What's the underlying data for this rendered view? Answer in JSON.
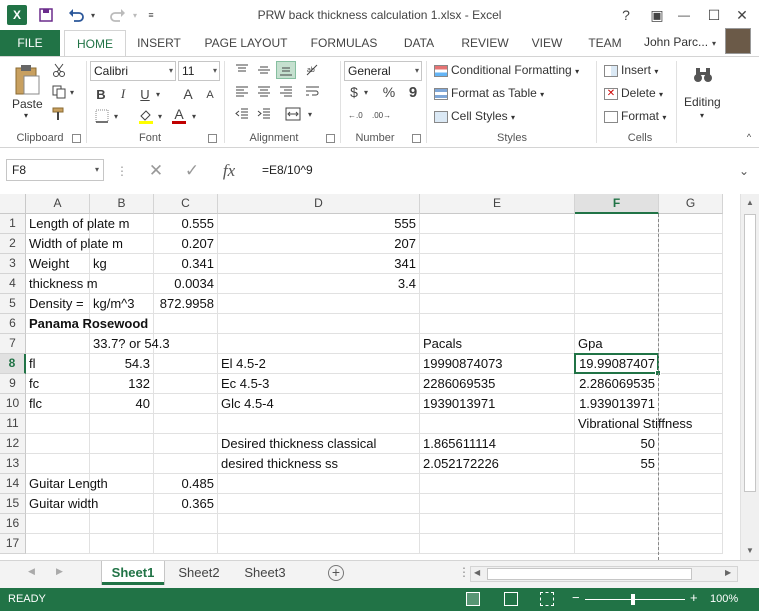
{
  "window": {
    "title": "PRW back thickness calculation 1.xlsx - Excel",
    "help": "?",
    "restore_ribbon": "▣",
    "minimize": "—",
    "maximize": "☐",
    "close": "✕",
    "logo_letter": "X"
  },
  "qat": {
    "save_icon": "save-icon",
    "undo_icon": "undo-icon",
    "redo_icon": "redo-icon"
  },
  "tabs": [
    "FILE",
    "HOME",
    "INSERT",
    "PAGE LAYOUT",
    "FORMULAS",
    "DATA",
    "REVIEW",
    "VIEW",
    "TEAM"
  ],
  "active_tab": "HOME",
  "user": {
    "name": "John Parc..."
  },
  "ribbon": {
    "clipboard": {
      "label": "Clipboard",
      "paste": "Paste"
    },
    "font": {
      "label": "Font",
      "name": "Calibri",
      "size": "11",
      "bold": "B",
      "italic": "I",
      "underline": "U",
      "grow": "A",
      "shrink": "A",
      "font_color": "A"
    },
    "alignment": {
      "label": "Alignment"
    },
    "number": {
      "label": "Number",
      "format": "General",
      "currency": "$",
      "percent": "%",
      "comma": "9"
    },
    "styles": {
      "label": "Styles",
      "conditional": "Conditional Formatting",
      "format_table": "Format as Table",
      "cell_styles": "Cell Styles"
    },
    "cells": {
      "label": "Cells",
      "insert": "Insert",
      "delete": "Delete",
      "format": "Format"
    },
    "editing": {
      "label": "Editing"
    }
  },
  "formula_bar": {
    "name_box": "F8",
    "formula": "=E8/10^9"
  },
  "columns": [
    "A",
    "B",
    "C",
    "D",
    "E",
    "F",
    "G"
  ],
  "selected_column": "F",
  "selected_row": "8",
  "rows": [
    "1",
    "2",
    "3",
    "4",
    "5",
    "6",
    "7",
    "8",
    "9",
    "10",
    "11",
    "12",
    "13",
    "14",
    "15",
    "16",
    "17"
  ],
  "cells": {
    "r1": {
      "A": "Length of plate m",
      "B": "",
      "C": "0.555",
      "D": "555",
      "E": "",
      "F": ""
    },
    "r2": {
      "A": "Width of plate m",
      "B": "",
      "C": "0.207",
      "D": "207",
      "E": "",
      "F": ""
    },
    "r3": {
      "A": "Weight",
      "B": "kg",
      "C": "0.341",
      "D": "341",
      "E": "",
      "F": ""
    },
    "r4": {
      "A": "thickness m",
      "B": "",
      "C": "0.0034",
      "D": "3.4",
      "E": "",
      "F": ""
    },
    "r5": {
      "A": "Density =",
      "B": "kg/m^3",
      "C": "872.9958",
      "D": "",
      "E": "",
      "F": ""
    },
    "r6": {
      "A": "Panama Rosewood",
      "B": "",
      "C": "",
      "D": "",
      "E": "",
      "F": ""
    },
    "r7": {
      "A": "",
      "B": "33.7? or 54.3",
      "C": "",
      "D": "",
      "E": "Pacals",
      "F": "Gpa"
    },
    "r8": {
      "A": "fl",
      "B": "54.3",
      "C": "",
      "D": "El 4.5-2",
      "E": "19990874073",
      "F": "19.99087407"
    },
    "r9": {
      "A": "fc",
      "B": "132",
      "C": "",
      "D": "Ec 4.5-3",
      "E": "2286069535",
      "F": "2.286069535"
    },
    "r10": {
      "A": "flc",
      "B": "40",
      "C": "",
      "D": "Glc 4.5-4",
      "E": "1939013971",
      "F": "1.939013971"
    },
    "r11": {
      "A": "",
      "B": "",
      "C": "",
      "D": "",
      "E": "",
      "F": "Vibrational Stiffness"
    },
    "r12": {
      "A": "",
      "B": "",
      "C": "",
      "D": "Desired thickness classical",
      "E": "1.865611114",
      "F": "50"
    },
    "r13": {
      "A": "",
      "B": "",
      "C": "",
      "D": "desired thickness ss",
      "E": "2.052172226",
      "F": "55"
    },
    "r14": {
      "A": "Guitar Length",
      "B": "",
      "C": "0.485",
      "D": "",
      "E": "",
      "F": ""
    },
    "r15": {
      "A": "Guitar width",
      "B": "",
      "C": "0.365",
      "D": "",
      "E": "",
      "F": ""
    },
    "r16": {
      "A": "",
      "B": "",
      "C": "",
      "D": "",
      "E": "",
      "F": ""
    },
    "r17": {
      "A": "",
      "B": "",
      "C": "",
      "D": "",
      "E": "",
      "F": ""
    }
  },
  "sheets": [
    "Sheet1",
    "Sheet2",
    "Sheet3"
  ],
  "active_sheet": "Sheet1",
  "status": {
    "ready": "READY",
    "zoom": "100%",
    "zoom_minus": "−",
    "zoom_plus": "+"
  },
  "colors": {
    "accent": "#217346"
  }
}
